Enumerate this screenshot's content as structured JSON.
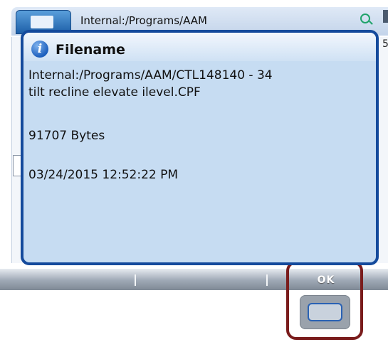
{
  "browser": {
    "path": "Internal:/Programs/AAM",
    "edge_char": "5"
  },
  "dialog": {
    "title": "Filename",
    "filename_line1": "Internal:/Programs/AAM/CTL148140 - 34",
    "filename_line2": "tilt recline elevate ilevel.CPF",
    "size": "91707 Bytes",
    "modified": "03/24/2015 12:52:22 PM"
  },
  "softkeys": {
    "ok_label": "OK"
  },
  "colors": {
    "dialog_border": "#144a9c",
    "dialog_body": "#c6dcf2",
    "highlight": "#7a1c1c"
  },
  "icons": {
    "info": "info-icon",
    "search": "search-icon",
    "back": "back-arrow-icon"
  }
}
